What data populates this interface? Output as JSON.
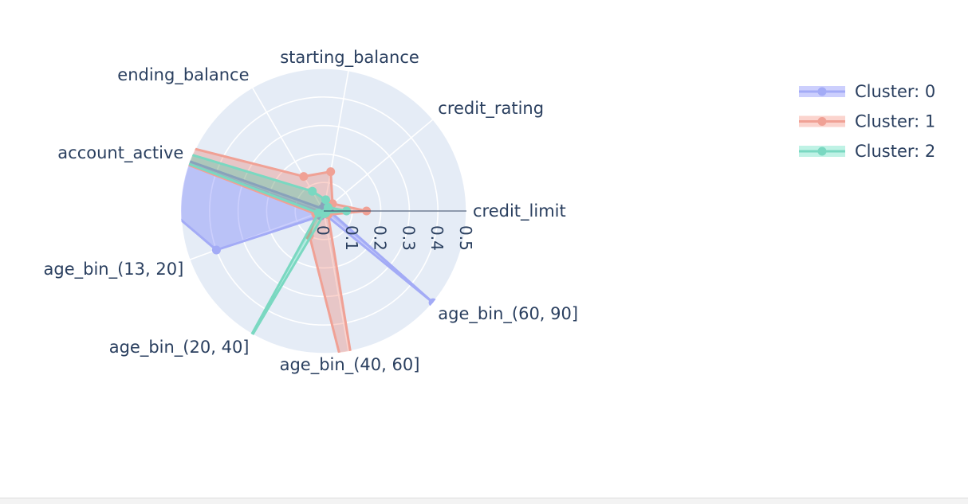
{
  "chart_data": {
    "type": "radar",
    "radial_range": [
      0,
      0.5
    ],
    "radial_ticks": [
      "0",
      "0.1",
      "0.2",
      "0.3",
      "0.4",
      "0.5"
    ],
    "categories": [
      "credit_limit",
      "credit_rating",
      "starting_balance",
      "ending_balance",
      "account_active",
      "age_bin_(13, 20]",
      "age_bin_(20, 40]",
      "age_bin_(40, 60]",
      "age_bin_(60, 90]"
    ],
    "series": [
      {
        "name": "Cluster: 0",
        "line_color": "#a3abf6",
        "fill_color": "rgba(99,110,250,0.33)",
        "values": [
          0.02,
          0.01,
          0.02,
          0.01,
          1.0,
          0.4,
          0.02,
          0.01,
          0.5
        ]
      },
      {
        "name": "Cluster: 1",
        "line_color": "#f0a195",
        "fill_color": "rgba(239,85,59,0.25)",
        "values": [
          0.15,
          0.04,
          0.14,
          0.14,
          1.0,
          0.03,
          0.1,
          0.95,
          0.02
        ]
      },
      {
        "name": "Cluster: 2",
        "line_color": "#7ad8c1",
        "fill_color": "rgba(0,204,150,0.25)",
        "values": [
          0.08,
          0.02,
          0.04,
          0.08,
          1.0,
          0.02,
          0.6,
          0.01,
          0.01
        ]
      }
    ],
    "legend_placement": "top-right"
  }
}
